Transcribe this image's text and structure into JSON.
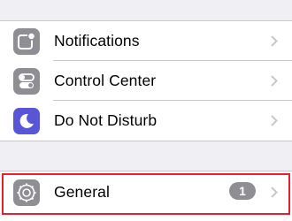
{
  "settings": {
    "rows": [
      {
        "label": "Notifications",
        "icon": "notifications-icon",
        "icon_color": "#8e8e93"
      },
      {
        "label": "Control Center",
        "icon": "control-center-icon",
        "icon_color": "#8e8e93"
      },
      {
        "label": "Do Not Disturb",
        "icon": "moon-icon",
        "icon_color": "#5856d6"
      }
    ],
    "general": {
      "label": "General",
      "icon": "gear-icon",
      "icon_color": "#8e8e93",
      "badge": "1"
    }
  },
  "colors": {
    "highlight": "#e8202c",
    "badge_bg": "#8e8e93",
    "chevron": "#c7c7cc",
    "background": "#efeff4"
  }
}
